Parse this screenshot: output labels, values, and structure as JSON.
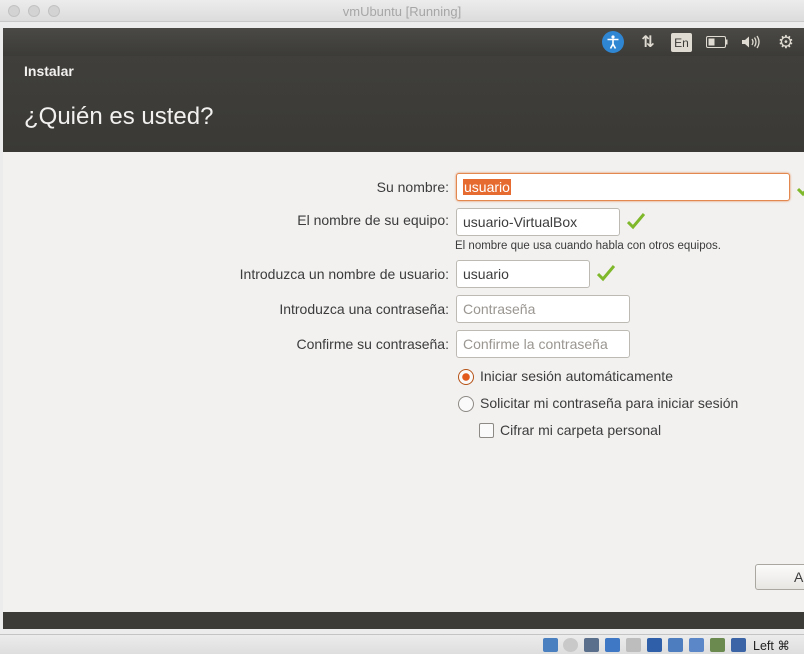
{
  "host_window": {
    "title": "vmUbuntu [Running]"
  },
  "panel": {
    "language": "En",
    "icons": [
      "accessibility-icon",
      "network-updown-icon",
      "battery-icon",
      "volume-icon",
      "gear-icon"
    ]
  },
  "installer": {
    "app_label": "Instalar",
    "page_title": "¿Quién es usted?",
    "fields": {
      "name": {
        "label": "Su nombre:",
        "value": "usuario"
      },
      "computer": {
        "label": "El nombre de su equipo:",
        "value": "usuario-VirtualBox",
        "hint": "El nombre que usa cuando habla con otros equipos."
      },
      "username": {
        "label": "Introduzca un nombre de usuario:",
        "value": "usuario"
      },
      "password": {
        "label": "Introduzca una contraseña:",
        "placeholder": "Contraseña"
      },
      "confirm": {
        "label": "Confirme su contraseña:",
        "placeholder": "Confirme la contraseña"
      }
    },
    "login_options": {
      "auto": "Iniciar sesión automáticamente",
      "require": "Solicitar mi contraseña para iniciar sesión",
      "encrypt": "Cifrar mi carpeta personal",
      "selected": "auto"
    },
    "next_button": "A"
  },
  "statusbar": {
    "host_key": "Left ⌘"
  },
  "colors": {
    "accent": "#e66b30",
    "panel": "#3c3b37",
    "check": "#7fb82a"
  }
}
